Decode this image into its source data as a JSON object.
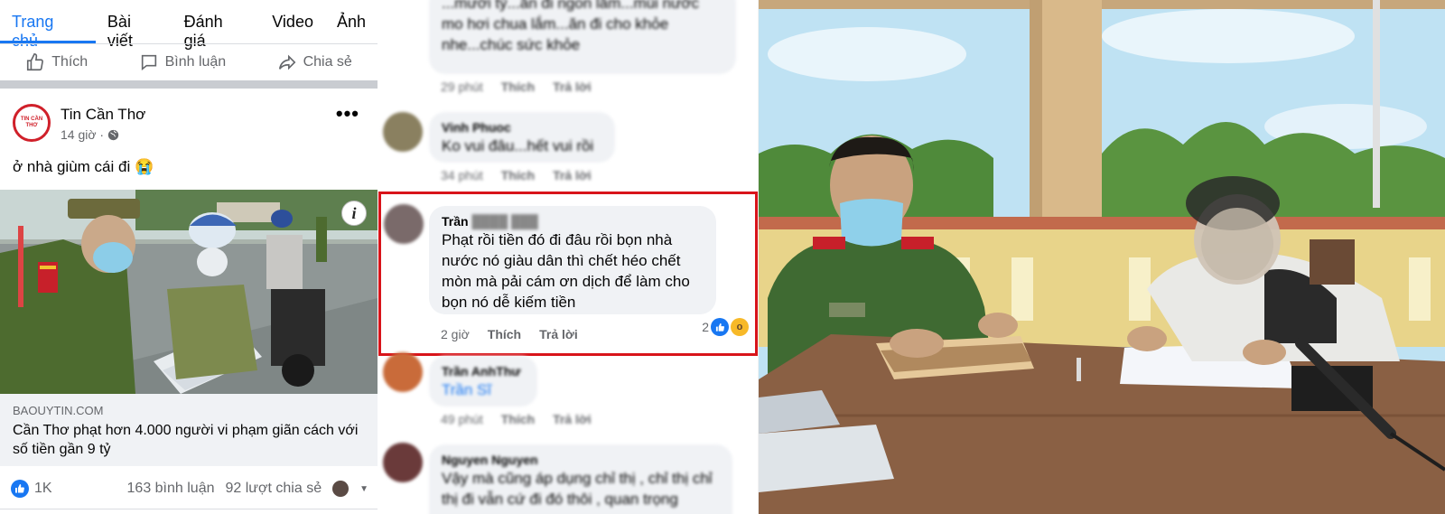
{
  "tabs": [
    "Trang chủ",
    "Bài viết",
    "Đánh giá",
    "Video",
    "Ảnh"
  ],
  "actions": {
    "like": "Thích",
    "comment": "Bình luận",
    "share": "Chia sẻ"
  },
  "post": {
    "page_name": "Tin Cần Thơ",
    "avatar_text": "TIN CẦN THƠ",
    "time": "14 giờ ·",
    "text": "ở nhà giùm cái đi 😭",
    "link_domain": "BAOUYTIN.COM",
    "link_title": "Cần Thơ phạt hơn 4.000 người vi phạm giãn cách với số tiền gần 9 tỷ",
    "likes": "1K",
    "comments": "163 bình luận",
    "shares": "92 lượt chia sẻ"
  },
  "comments": [
    {
      "name": "",
      "text": "...mười tỷ...ăn đi ngon lắm...mùi nước mo hơi chua lắm...ăn đi cho khỏe nhe...chúc sức khỏe",
      "time": "29 phút",
      "like": "Thích",
      "reply": "Trả lời"
    },
    {
      "name": "Vinh Phuoc",
      "text": "Ko vui đâu...hết vui rồi",
      "time": "34 phút",
      "like": "Thích",
      "reply": "Trả lời"
    },
    {
      "name": "Trần",
      "text": "Phạt rồi tiền đó đi đâu rồi bọn nhà nước nó giàu dân thì chết héo chết mòn mà pải cám ơn dịch để làm cho bọn nó dễ kiếm tiền",
      "time": "2 giờ",
      "like": "Thích",
      "reply": "Trả lời",
      "reactions": "2"
    },
    {
      "name": "Trần AnhThư",
      "text": "Trần Sĩ",
      "time": "49 phút",
      "like": "Thích",
      "reply": "Trả lời"
    },
    {
      "name": "Nguyen Nguyen",
      "text": "Vậy mà cũng áp dụng chỉ thị , chỉ thị chỉ thị đi vẫn cứ đi đó thôi , quan trọng",
      "time": "",
      "like": "",
      "reply": ""
    }
  ],
  "colors": {
    "accent": "#1877f2",
    "highlight": "#d8141a",
    "muted": "#65676b",
    "bubble": "#f0f2f5"
  }
}
